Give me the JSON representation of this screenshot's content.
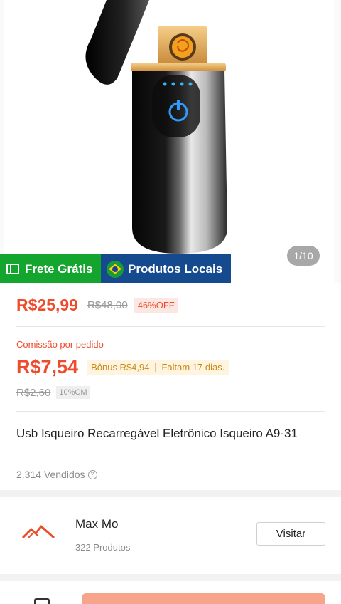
{
  "image": {
    "counter": "1/10",
    "badges": {
      "frete": "Frete Grátis",
      "local": "Produtos Locais"
    }
  },
  "price": {
    "current": "R$25,99",
    "original": "R$48,00",
    "discount": "46%OFF"
  },
  "commission": {
    "label": "Comissão por pedido",
    "value": "R$7,54",
    "bonus": "Bônus R$4,94",
    "remaining": "Faltam 17 dias.",
    "old_value": "R$2,60",
    "rate": "10%CM"
  },
  "product": {
    "title": "Usb Isqueiro Recarregável Eletrônico Isqueiro A9-31",
    "sold": "2.314 Vendidos"
  },
  "shop": {
    "name": "Max Mo",
    "products": "322 Produtos",
    "visit_label": "Visitar"
  },
  "colors": {
    "accent": "#ee4d2d",
    "frete_badge": "#13a52e",
    "local_badge": "#154a8f",
    "bonus_text": "#c88a14",
    "cta": "#f7a48d"
  }
}
